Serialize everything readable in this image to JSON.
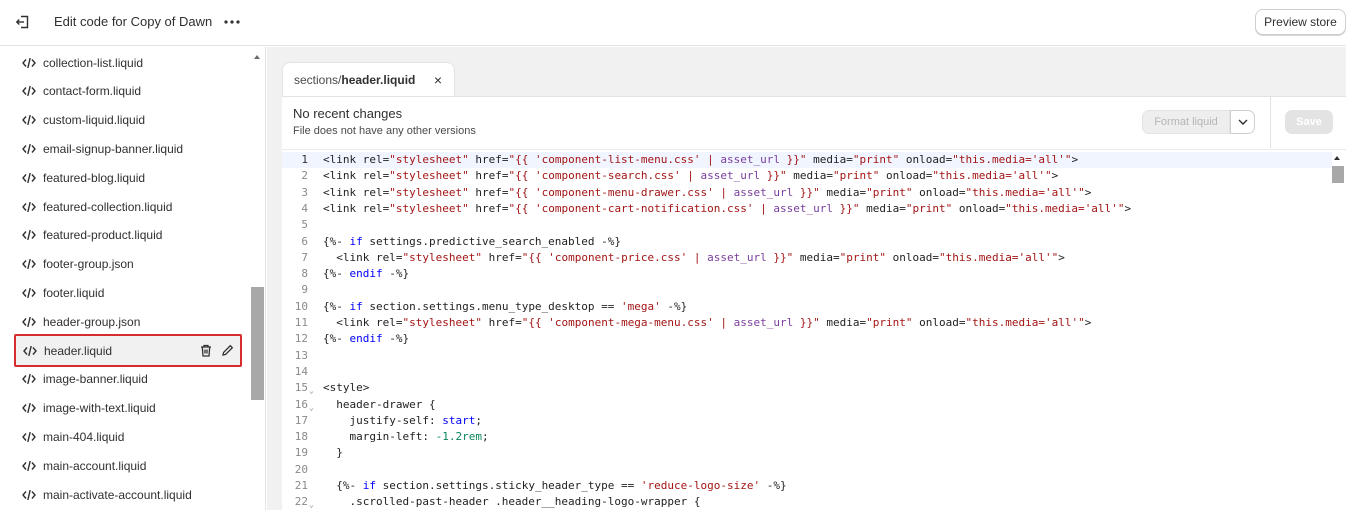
{
  "topbar": {
    "title": "Edit code for Copy of Dawn",
    "preview_label": "Preview store"
  },
  "sidebar": {
    "files": [
      {
        "name": "collection-list.liquid"
      },
      {
        "name": "contact-form.liquid"
      },
      {
        "name": "custom-liquid.liquid"
      },
      {
        "name": "email-signup-banner.liquid"
      },
      {
        "name": "featured-blog.liquid"
      },
      {
        "name": "featured-collection.liquid"
      },
      {
        "name": "featured-product.liquid"
      },
      {
        "name": "footer-group.json"
      },
      {
        "name": "footer.liquid"
      },
      {
        "name": "header-group.json"
      },
      {
        "name": "header.liquid",
        "selected": true
      },
      {
        "name": "image-banner.liquid"
      },
      {
        "name": "image-with-text.liquid"
      },
      {
        "name": "main-404.liquid"
      },
      {
        "name": "main-account.liquid"
      },
      {
        "name": "main-activate-account.liquid"
      }
    ]
  },
  "tab": {
    "dir": "sections/",
    "file": "header.liquid"
  },
  "status": {
    "title": "No recent changes",
    "subtitle": "File does not have any other versions"
  },
  "toolbar": {
    "format_label": "Format liquid",
    "save_label": "Save"
  },
  "code_lines": [
    {
      "n": "1",
      "text": "<link rel=\"stylesheet\" href=\"{{ 'component-list-menu.css' | asset_url }}\" media=\"print\" onload=\"this.media='all'\">"
    },
    {
      "n": "2",
      "text": "<link rel=\"stylesheet\" href=\"{{ 'component-search.css' | asset_url }}\" media=\"print\" onload=\"this.media='all'\">"
    },
    {
      "n": "3",
      "text": "<link rel=\"stylesheet\" href=\"{{ 'component-menu-drawer.css' | asset_url }}\" media=\"print\" onload=\"this.media='all'\">"
    },
    {
      "n": "4",
      "text": "<link rel=\"stylesheet\" href=\"{{ 'component-cart-notification.css' | asset_url }}\" media=\"print\" onload=\"this.media='all'\">"
    },
    {
      "n": "5",
      "text": ""
    },
    {
      "n": "6",
      "text": "{%- if settings.predictive_search_enabled -%}"
    },
    {
      "n": "7",
      "text": "  <link rel=\"stylesheet\" href=\"{{ 'component-price.css' | asset_url }}\" media=\"print\" onload=\"this.media='all'\">"
    },
    {
      "n": "8",
      "text": "{%- endif -%}"
    },
    {
      "n": "9",
      "text": ""
    },
    {
      "n": "10",
      "text": "{%- if section.settings.menu_type_desktop == 'mega' -%}"
    },
    {
      "n": "11",
      "text": "  <link rel=\"stylesheet\" href=\"{{ 'component-mega-menu.css' | asset_url }}\" media=\"print\" onload=\"this.media='all'\">"
    },
    {
      "n": "12",
      "text": "{%- endif -%}"
    },
    {
      "n": "13",
      "text": ""
    },
    {
      "n": "14",
      "text": ""
    },
    {
      "n": "15",
      "text": "<style>",
      "fold": true
    },
    {
      "n": "16",
      "text": "  header-drawer {",
      "fold": true
    },
    {
      "n": "17",
      "text": "    justify-self: start;"
    },
    {
      "n": "18",
      "text": "    margin-left: -1.2rem;"
    },
    {
      "n": "19",
      "text": "  }"
    },
    {
      "n": "20",
      "text": ""
    },
    {
      "n": "21",
      "text": "  {%- if section.settings.sticky_header_type == 'reduce-logo-size' -%}"
    },
    {
      "n": "22",
      "text": "    .scrolled-past-header .header__heading-logo-wrapper {",
      "fold": true
    }
  ]
}
